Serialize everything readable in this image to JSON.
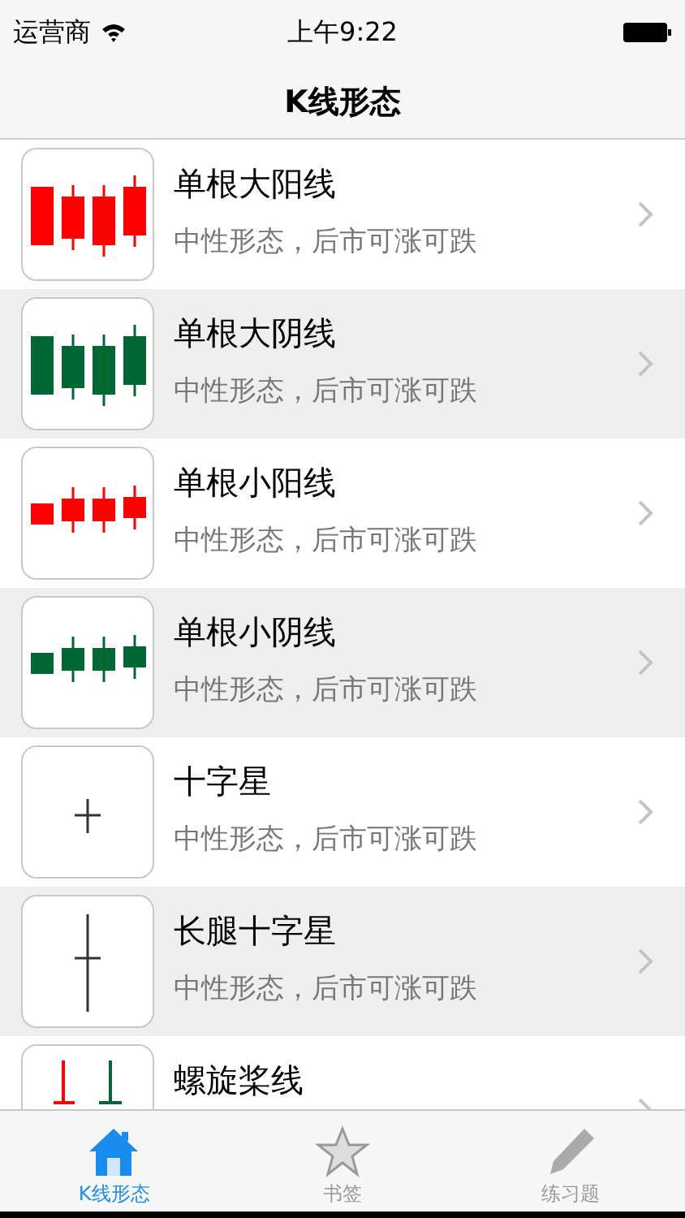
{
  "status_bar": {
    "carrier": "运营商",
    "time": "上午9:22"
  },
  "nav": {
    "title": "K线形态"
  },
  "rows": [
    {
      "kind": "big-up",
      "title": "单根大阳线",
      "subtitle": "中性形态，后市可涨可跌"
    },
    {
      "kind": "big-down",
      "title": "单根大阴线",
      "subtitle": "中性形态，后市可涨可跌"
    },
    {
      "kind": "small-up",
      "title": "单根小阳线",
      "subtitle": "中性形态，后市可涨可跌"
    },
    {
      "kind": "small-down",
      "title": "单根小阴线",
      "subtitle": "中性形态，后市可涨可跌"
    },
    {
      "kind": "doji",
      "title": "十字星",
      "subtitle": "中性形态，后市可涨可跌"
    },
    {
      "kind": "long-doji",
      "title": "长腿十字星",
      "subtitle": "中性形态，后市可涨可跌"
    },
    {
      "kind": "spinning",
      "title": "螺旋桨线"
    }
  ],
  "tabs": [
    {
      "kind": "home",
      "label": "K线形态",
      "selected": true
    },
    {
      "kind": "star",
      "label": "书签",
      "selected": false
    },
    {
      "kind": "pencil",
      "label": "练习题",
      "selected": false
    }
  ]
}
